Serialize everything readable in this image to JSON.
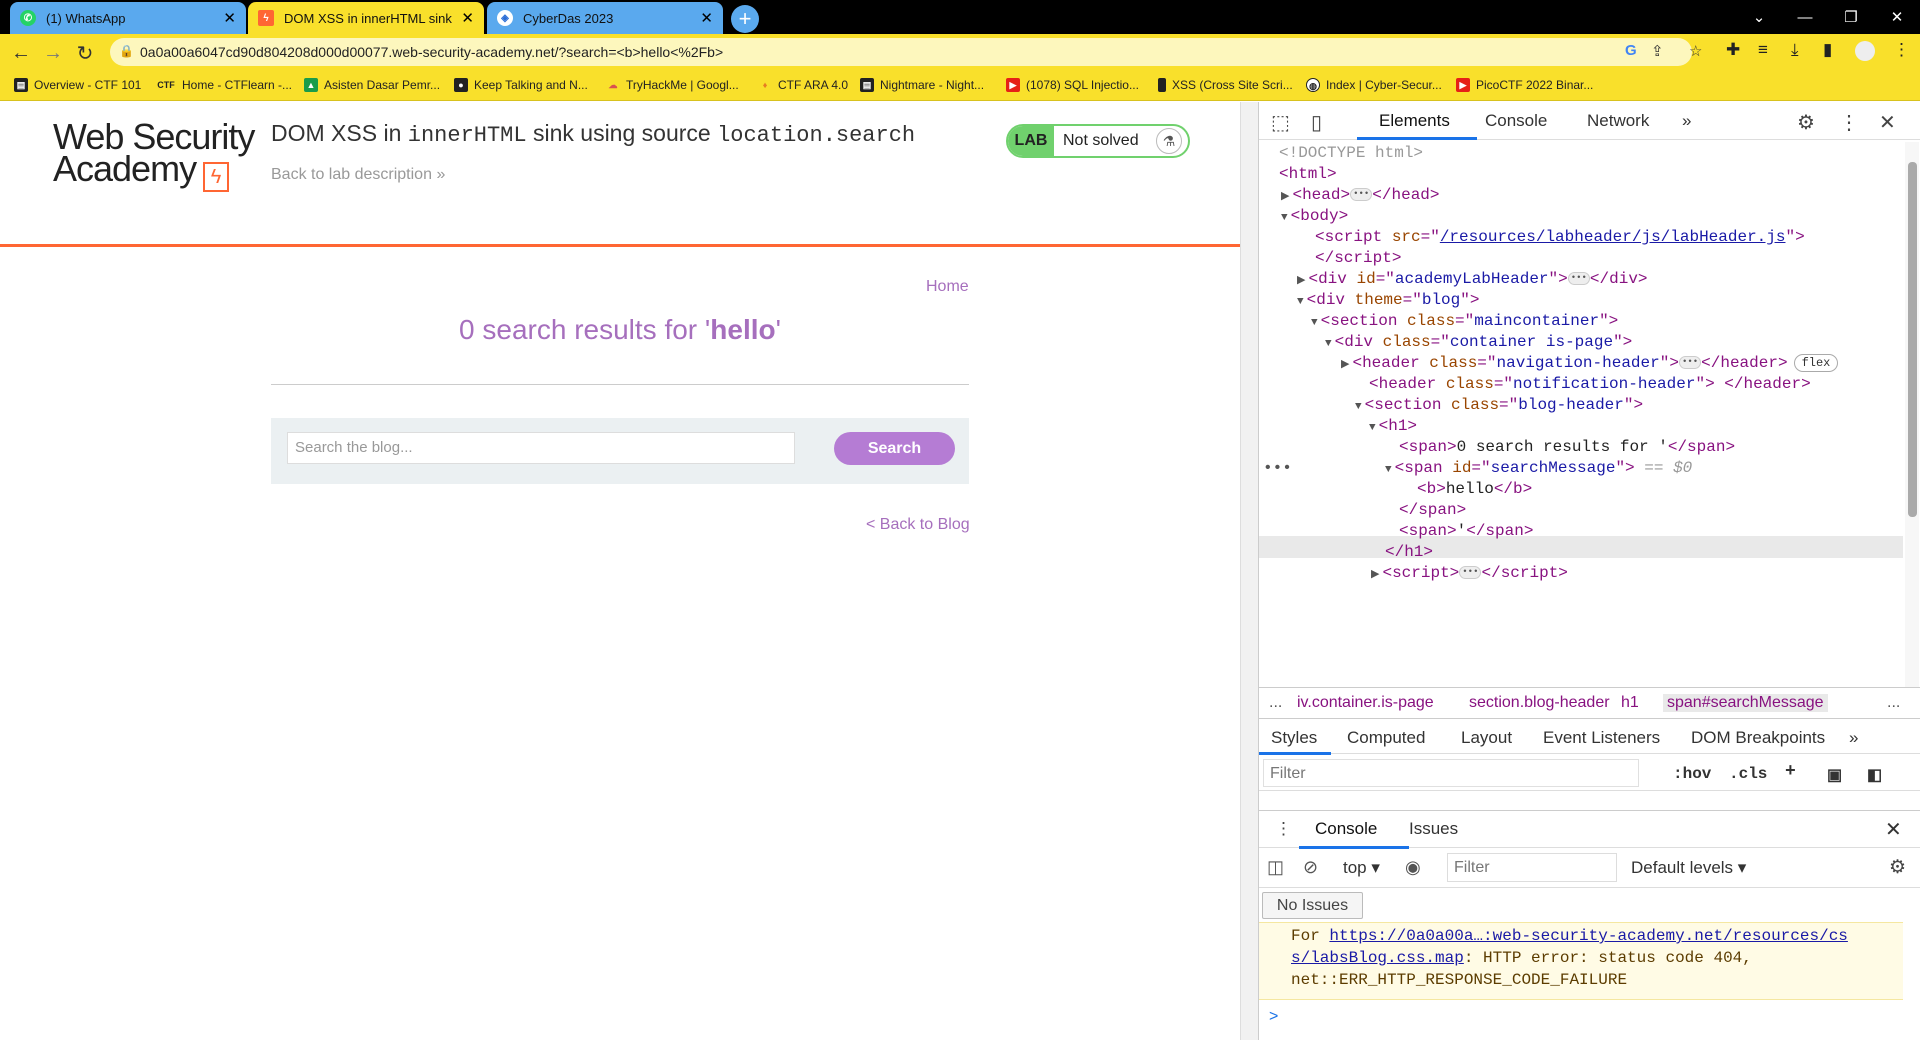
{
  "browser": {
    "tabs": [
      {
        "title": "(1) WhatsApp",
        "icon": "whatsapp-icon"
      },
      {
        "title": "DOM XSS in innerHTML sink usin",
        "icon": "burp-icon"
      },
      {
        "title": "CyberDas 2023",
        "icon": "shield-icon"
      }
    ],
    "new_tab_glyph": "+",
    "url": "0a0a00a6047cd90d804208d000d00077.web-security-academy.net/?search=<b>hello<%2Fb>",
    "bookmarks": [
      {
        "label": "Overview - CTF 101"
      },
      {
        "label": "Home - CTFlearn -..."
      },
      {
        "label": "Asisten Dasar Pemr..."
      },
      {
        "label": "Keep Talking and N..."
      },
      {
        "label": "TryHackMe | Googl..."
      },
      {
        "label": "CTF ARA 4.0"
      },
      {
        "label": "Nightmare - Night..."
      },
      {
        "label": "(1078) SQL Injectio..."
      },
      {
        "label": "XSS (Cross Site Scri..."
      },
      {
        "label": "Index | Cyber-Secur..."
      },
      {
        "label": "PicoCTF 2022 Binar..."
      }
    ],
    "bookmark_ctf_glyph": "CTF"
  },
  "page": {
    "logo_line1": "Web Security",
    "logo_line2": "Academy",
    "title_prefix": "DOM XSS in ",
    "title_code1": "innerHTML",
    "title_mid": " sink using source ",
    "title_code2": "location.search",
    "back_description": "Back to lab description",
    "back_glyph": "»",
    "lab_label": "LAB",
    "lab_status": "Not solved",
    "home_link": "Home",
    "results_prefix": "0 search results for '",
    "results_term": "hello",
    "results_suffix": "'",
    "search_placeholder": "Search the blog...",
    "search_button": "Search",
    "back_to_blog": "< Back to Blog"
  },
  "devtools": {
    "tabs": [
      "Elements",
      "Console",
      "Network"
    ],
    "more_glyph": "»",
    "dom": {
      "doctype": "<!DOCTYPE html>",
      "script_src": "/resources/labheader/js/labHeader.js",
      "header_id": "academyLabHeader",
      "theme": "blog",
      "maincontainer": "maincontainer",
      "container": "container is-page",
      "nav_header": "navigation-header",
      "notif_header": "notification-header",
      "blog_header": "blog-header",
      "span_text1": "0 search results for '",
      "span_id": "searchMessage",
      "eq_dollar": "== $0",
      "b_text": "hello",
      "span_text2": "'",
      "flex_badge": "flex"
    },
    "breadcrumbs": [
      "...",
      "iv.container.is-page",
      "section.blog-header",
      "h1",
      "span#searchMessage",
      "..."
    ],
    "style_tabs": [
      "Styles",
      "Computed",
      "Layout",
      "Event Listeners",
      "DOM Breakpoints"
    ],
    "filter_placeholder": "Filter",
    "hov": ":hov",
    "cls": ".cls",
    "drawer_tabs": [
      "Console",
      "Issues"
    ],
    "context": "top",
    "console_filter": "Filter",
    "levels": "Default levels",
    "no_issues": "No Issues",
    "msg_line1_prefix": "For ",
    "msg_line1_link": "https://0a0a00a…:web-security-academy.net/resources/cs",
    "msg_line2_link": "s/labsBlog.css.map",
    "msg_line2_rest": ": HTTP error: status code 404,",
    "msg_line3": "net::ERR_HTTP_RESPONSE_CODE_FAILURE",
    "prompt": ">"
  }
}
